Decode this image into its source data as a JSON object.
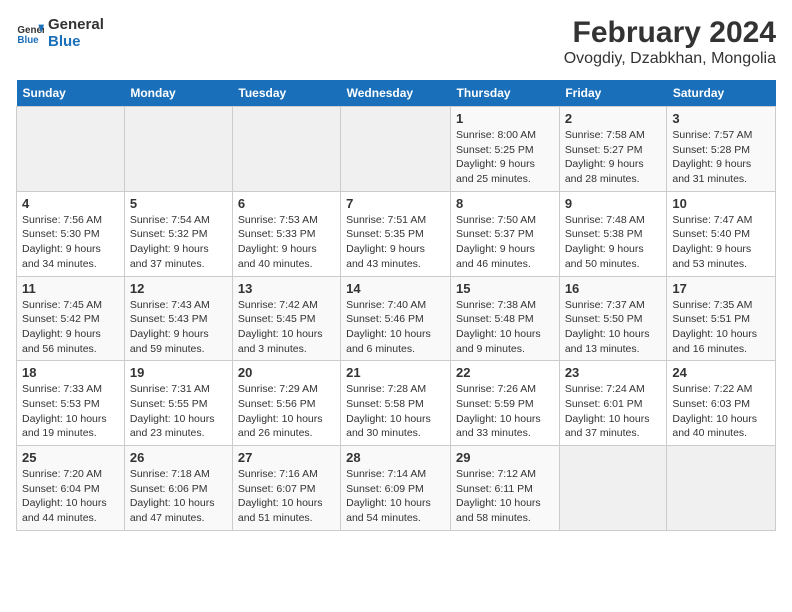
{
  "header": {
    "logo_line1": "General",
    "logo_line2": "Blue",
    "title": "February 2024",
    "subtitle": "Ovogdiy, Dzabkhan, Mongolia"
  },
  "days_of_week": [
    "Sunday",
    "Monday",
    "Tuesday",
    "Wednesday",
    "Thursday",
    "Friday",
    "Saturday"
  ],
  "weeks": [
    [
      {
        "day": "",
        "info": ""
      },
      {
        "day": "",
        "info": ""
      },
      {
        "day": "",
        "info": ""
      },
      {
        "day": "",
        "info": ""
      },
      {
        "day": "1",
        "info": "Sunrise: 8:00 AM\nSunset: 5:25 PM\nDaylight: 9 hours\nand 25 minutes."
      },
      {
        "day": "2",
        "info": "Sunrise: 7:58 AM\nSunset: 5:27 PM\nDaylight: 9 hours\nand 28 minutes."
      },
      {
        "day": "3",
        "info": "Sunrise: 7:57 AM\nSunset: 5:28 PM\nDaylight: 9 hours\nand 31 minutes."
      }
    ],
    [
      {
        "day": "4",
        "info": "Sunrise: 7:56 AM\nSunset: 5:30 PM\nDaylight: 9 hours\nand 34 minutes."
      },
      {
        "day": "5",
        "info": "Sunrise: 7:54 AM\nSunset: 5:32 PM\nDaylight: 9 hours\nand 37 minutes."
      },
      {
        "day": "6",
        "info": "Sunrise: 7:53 AM\nSunset: 5:33 PM\nDaylight: 9 hours\nand 40 minutes."
      },
      {
        "day": "7",
        "info": "Sunrise: 7:51 AM\nSunset: 5:35 PM\nDaylight: 9 hours\nand 43 minutes."
      },
      {
        "day": "8",
        "info": "Sunrise: 7:50 AM\nSunset: 5:37 PM\nDaylight: 9 hours\nand 46 minutes."
      },
      {
        "day": "9",
        "info": "Sunrise: 7:48 AM\nSunset: 5:38 PM\nDaylight: 9 hours\nand 50 minutes."
      },
      {
        "day": "10",
        "info": "Sunrise: 7:47 AM\nSunset: 5:40 PM\nDaylight: 9 hours\nand 53 minutes."
      }
    ],
    [
      {
        "day": "11",
        "info": "Sunrise: 7:45 AM\nSunset: 5:42 PM\nDaylight: 9 hours\nand 56 minutes."
      },
      {
        "day": "12",
        "info": "Sunrise: 7:43 AM\nSunset: 5:43 PM\nDaylight: 9 hours\nand 59 minutes."
      },
      {
        "day": "13",
        "info": "Sunrise: 7:42 AM\nSunset: 5:45 PM\nDaylight: 10 hours\nand 3 minutes."
      },
      {
        "day": "14",
        "info": "Sunrise: 7:40 AM\nSunset: 5:46 PM\nDaylight: 10 hours\nand 6 minutes."
      },
      {
        "day": "15",
        "info": "Sunrise: 7:38 AM\nSunset: 5:48 PM\nDaylight: 10 hours\nand 9 minutes."
      },
      {
        "day": "16",
        "info": "Sunrise: 7:37 AM\nSunset: 5:50 PM\nDaylight: 10 hours\nand 13 minutes."
      },
      {
        "day": "17",
        "info": "Sunrise: 7:35 AM\nSunset: 5:51 PM\nDaylight: 10 hours\nand 16 minutes."
      }
    ],
    [
      {
        "day": "18",
        "info": "Sunrise: 7:33 AM\nSunset: 5:53 PM\nDaylight: 10 hours\nand 19 minutes."
      },
      {
        "day": "19",
        "info": "Sunrise: 7:31 AM\nSunset: 5:55 PM\nDaylight: 10 hours\nand 23 minutes."
      },
      {
        "day": "20",
        "info": "Sunrise: 7:29 AM\nSunset: 5:56 PM\nDaylight: 10 hours\nand 26 minutes."
      },
      {
        "day": "21",
        "info": "Sunrise: 7:28 AM\nSunset: 5:58 PM\nDaylight: 10 hours\nand 30 minutes."
      },
      {
        "day": "22",
        "info": "Sunrise: 7:26 AM\nSunset: 5:59 PM\nDaylight: 10 hours\nand 33 minutes."
      },
      {
        "day": "23",
        "info": "Sunrise: 7:24 AM\nSunset: 6:01 PM\nDaylight: 10 hours\nand 37 minutes."
      },
      {
        "day": "24",
        "info": "Sunrise: 7:22 AM\nSunset: 6:03 PM\nDaylight: 10 hours\nand 40 minutes."
      }
    ],
    [
      {
        "day": "25",
        "info": "Sunrise: 7:20 AM\nSunset: 6:04 PM\nDaylight: 10 hours\nand 44 minutes."
      },
      {
        "day": "26",
        "info": "Sunrise: 7:18 AM\nSunset: 6:06 PM\nDaylight: 10 hours\nand 47 minutes."
      },
      {
        "day": "27",
        "info": "Sunrise: 7:16 AM\nSunset: 6:07 PM\nDaylight: 10 hours\nand 51 minutes."
      },
      {
        "day": "28",
        "info": "Sunrise: 7:14 AM\nSunset: 6:09 PM\nDaylight: 10 hours\nand 54 minutes."
      },
      {
        "day": "29",
        "info": "Sunrise: 7:12 AM\nSunset: 6:11 PM\nDaylight: 10 hours\nand 58 minutes."
      },
      {
        "day": "",
        "info": ""
      },
      {
        "day": "",
        "info": ""
      }
    ]
  ]
}
